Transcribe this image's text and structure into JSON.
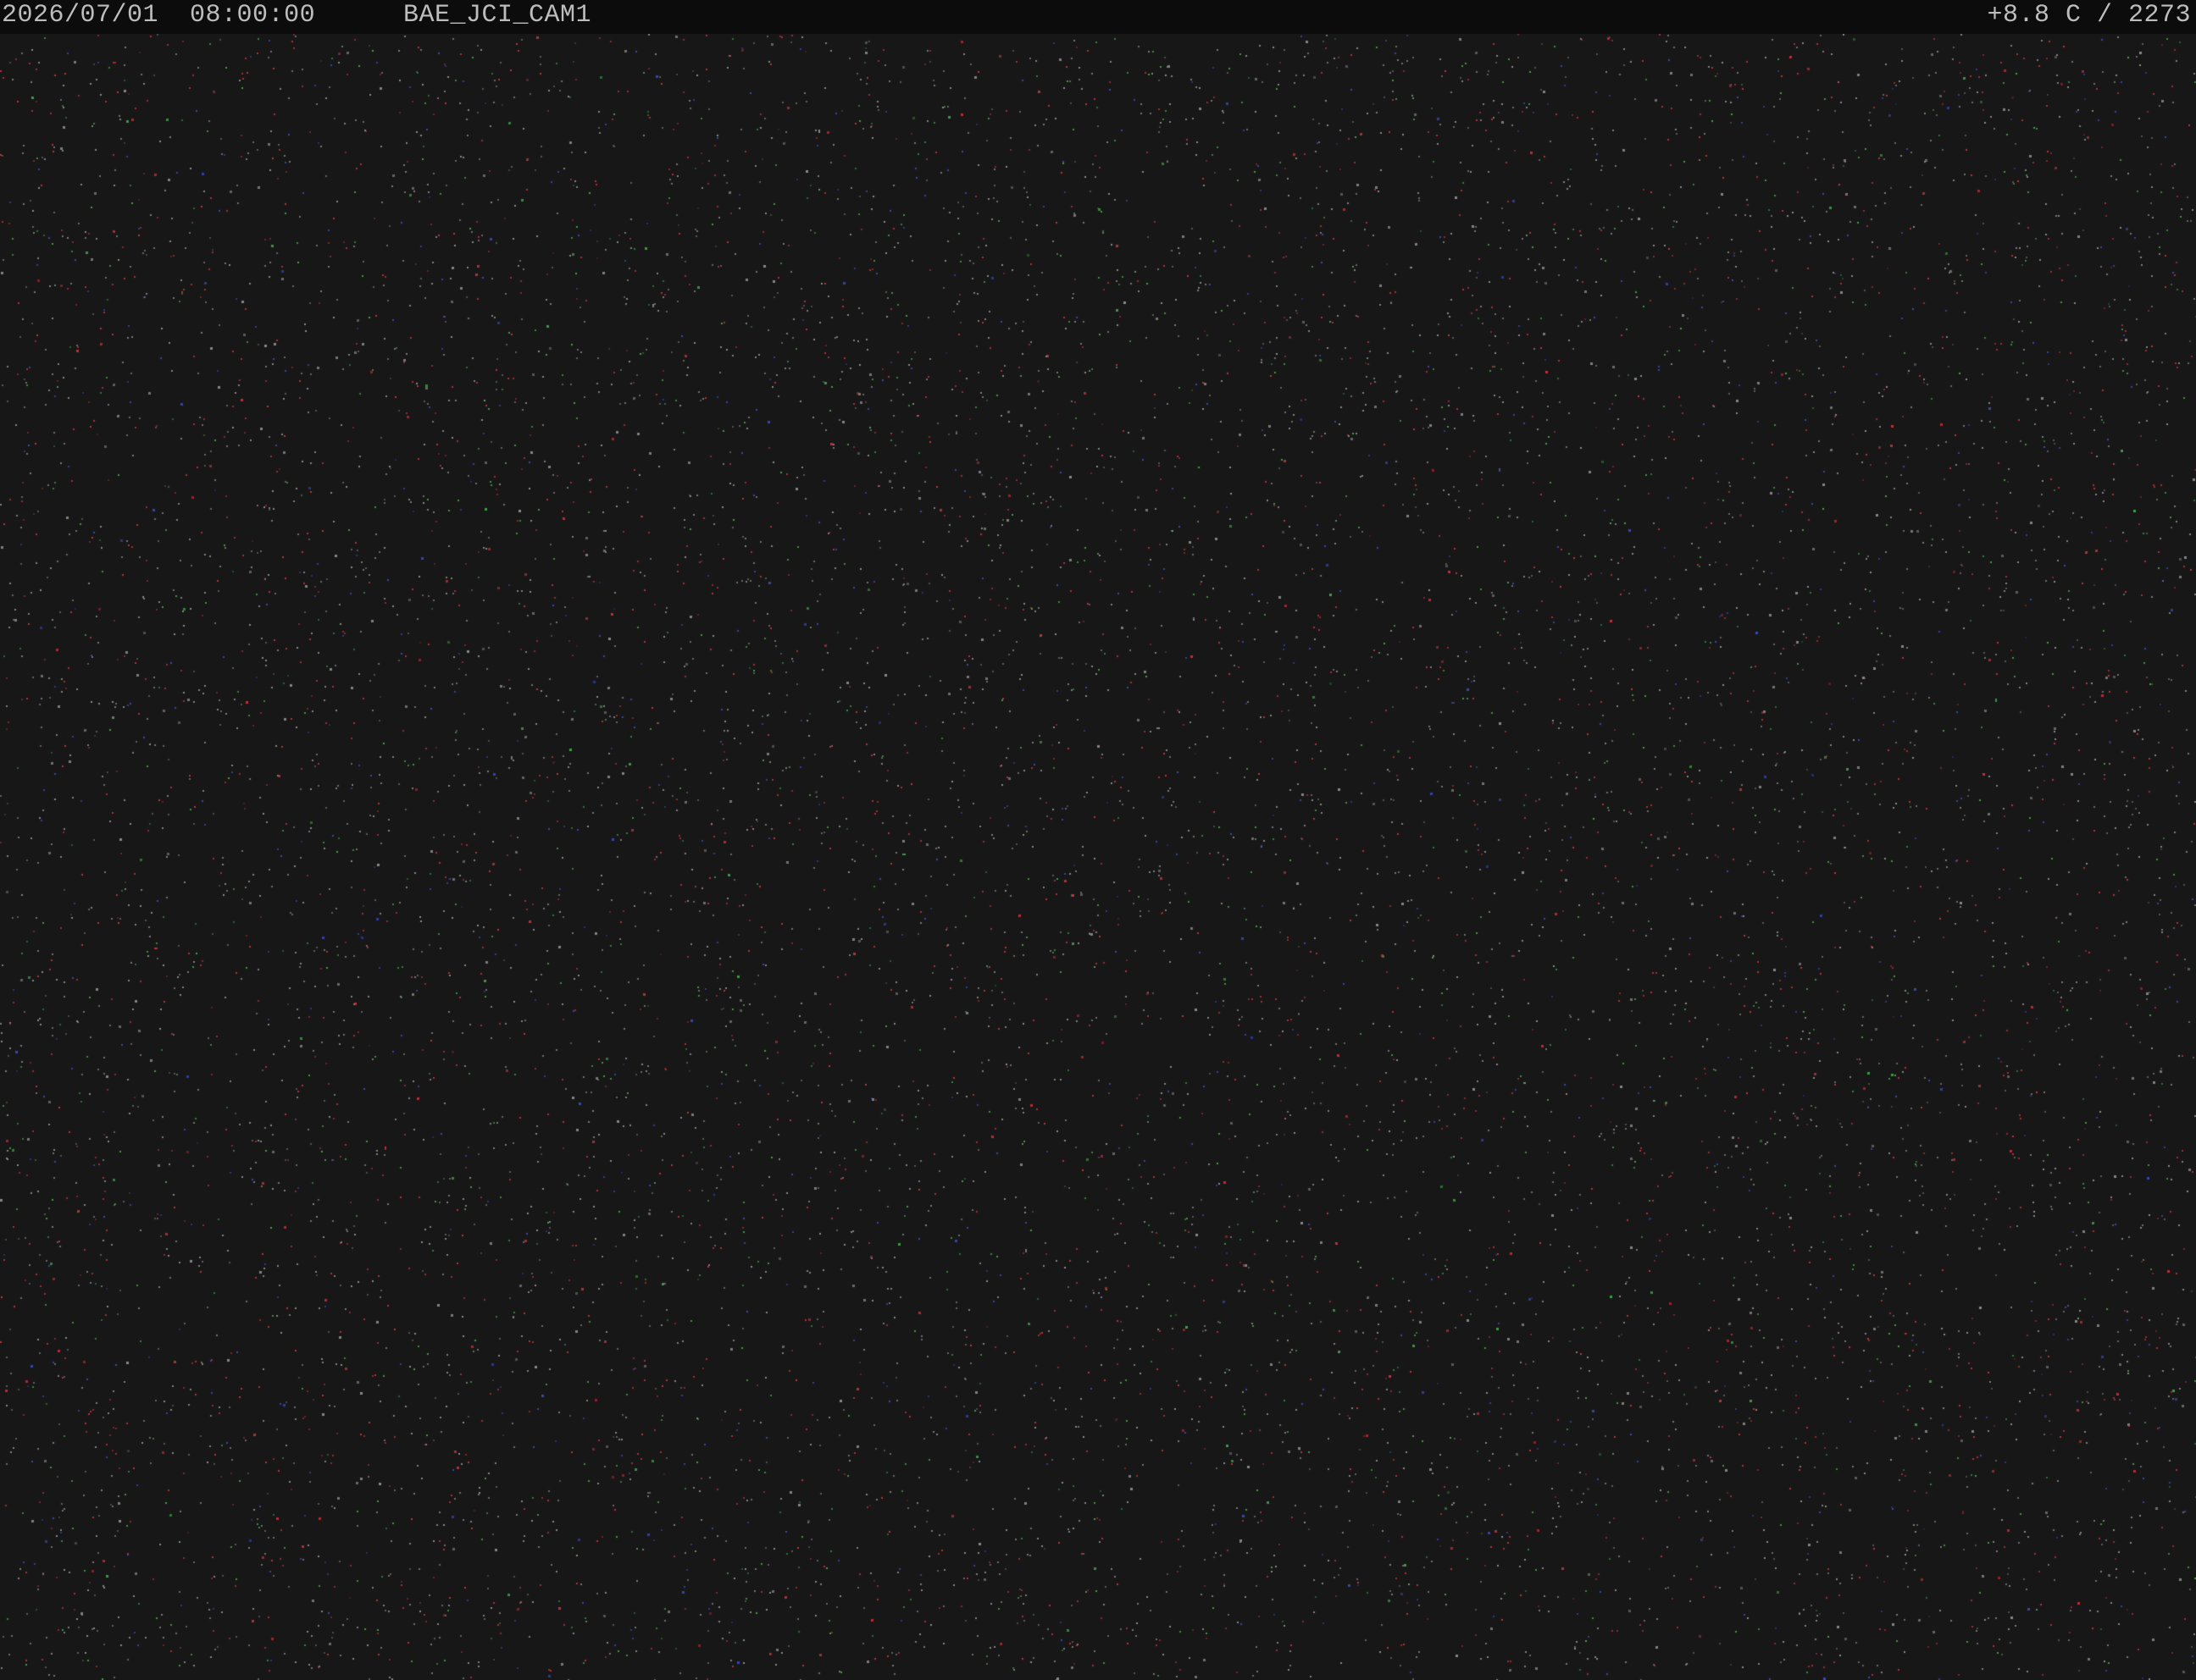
{
  "overlay": {
    "date": "2026/07/01",
    "time": "08:00:00",
    "camera_id": "BAE_JCI_CAM1",
    "sensor_readout": "+8.8 C / 2273"
  },
  "scene": {
    "description_icon": "dark-night-sky-noise",
    "background_color": "#171717",
    "overlay_bar_color": "#0c0c0c",
    "text_color": "#bdbdbd",
    "noise_colors": [
      "#c0303a",
      "#3fa048",
      "#3848b8",
      "#8a8a8a"
    ]
  }
}
